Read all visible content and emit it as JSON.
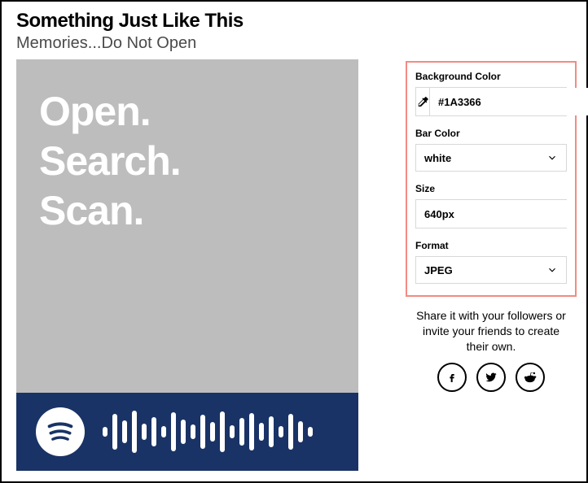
{
  "track": {
    "title": "Something Just Like This",
    "album": "Memories...Do Not Open"
  },
  "preview": {
    "line1": "Open.",
    "line2": "Search.",
    "line3": "Scan."
  },
  "options": {
    "bgcolor": {
      "label": "Background Color",
      "value": "#1A3366"
    },
    "barcolor": {
      "label": "Bar Color",
      "value": "white"
    },
    "size": {
      "label": "Size",
      "value": "640px"
    },
    "format": {
      "label": "Format",
      "value": "JPEG"
    }
  },
  "share": {
    "text": "Share it with your followers or invite your friends to create their own."
  },
  "icons": {
    "eyedropper": "eyedropper-icon",
    "facebook": "facebook-icon",
    "twitter": "twitter-icon",
    "reddit": "reddit-icon",
    "spotify": "spotify-icon"
  }
}
